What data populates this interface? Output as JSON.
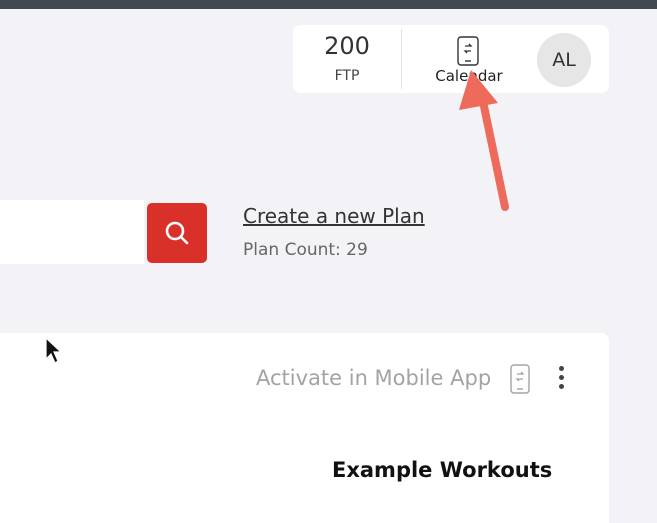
{
  "header": {
    "ftp_value": "200",
    "ftp_label": "FTP",
    "calendar_label": "Calendar",
    "avatar_initials": "AL"
  },
  "search": {
    "placeholder": "",
    "button_icon": "search-icon"
  },
  "plans": {
    "create_link": "Create a new Plan",
    "count_text": "Plan Count: 29"
  },
  "card": {
    "activate_label": "Activate in Mobile App",
    "activate_icon": "phone-sync-icon",
    "menu_icon": "kebab-menu-icon",
    "section_title": "Example Workouts"
  },
  "colors": {
    "accent_red": "#d9302a",
    "annotation_arrow": "#ee6a5a",
    "top_strip": "#434a4f"
  }
}
